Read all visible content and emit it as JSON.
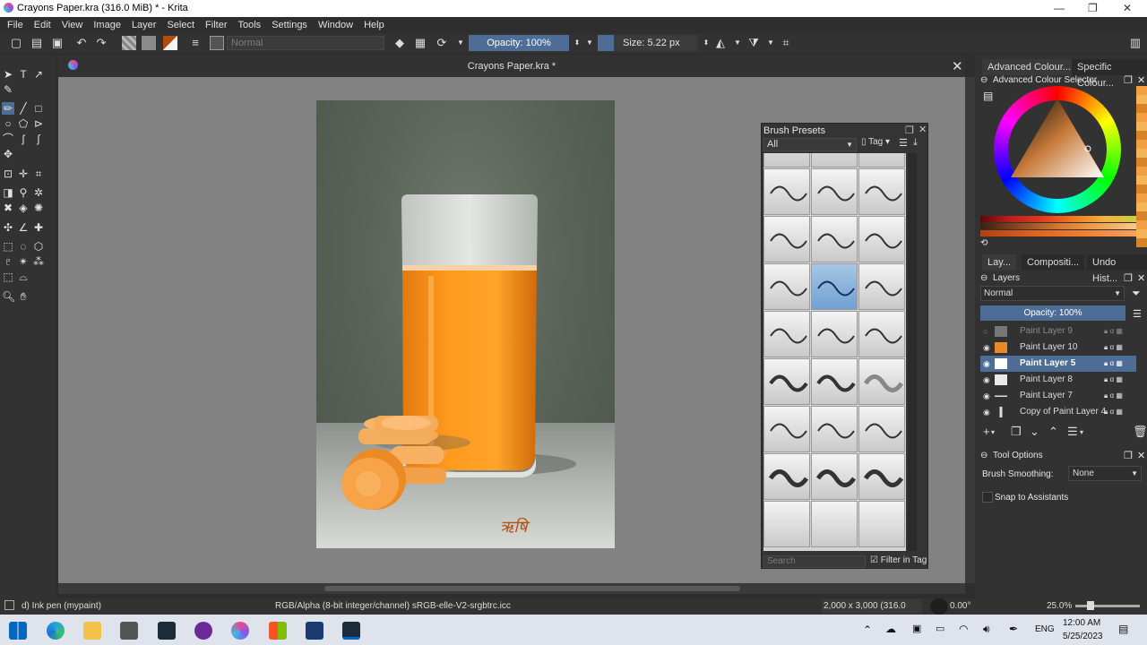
{
  "window": {
    "title": "Crayons Paper.kra (316.0 MiB)  * - Krita",
    "min": "—",
    "max": "❐",
    "close": "✕"
  },
  "menu": [
    "File",
    "Edit",
    "View",
    "Image",
    "Layer",
    "Select",
    "Filter",
    "Tools",
    "Settings",
    "Window",
    "Help"
  ],
  "toolbar": {
    "blend_mode": "Normal",
    "opacity": "Opacity: 100%",
    "size": "Size: 5.22 px"
  },
  "document": {
    "tab_name": "Crayons Paper.kra *"
  },
  "brush_presets": {
    "title": "Brush Presets",
    "tag_filter": "All",
    "tag_button": "Tag",
    "search_placeholder": "Search",
    "filter_in_tag": "Filter in Tag"
  },
  "right_dock": {
    "tabs_top": [
      "Advanced Colour...",
      "Specific Colour..."
    ],
    "colour_selector_title": "Advanced Colour Selector",
    "tabs_mid": [
      "Lay...",
      "Compositi...",
      "Undo Hist..."
    ],
    "layers_title": "Layers",
    "layers_blend": "Normal",
    "layers_opacity": "Opacity:  100%",
    "layers": [
      {
        "name": "Paint Layer 9"
      },
      {
        "name": "Paint Layer 10"
      },
      {
        "name": "Paint Layer 5"
      },
      {
        "name": "Paint Layer 8"
      },
      {
        "name": "Paint Layer 7"
      },
      {
        "name": "Copy of Paint Layer 4"
      }
    ],
    "tool_options_title": "Tool Options",
    "brush_smoothing_label": "Brush Smoothing:",
    "brush_smoothing_value": "None",
    "snap_label": "Snap to Assistants"
  },
  "status": {
    "brush": "d) Ink pen (mypaint)",
    "color_space": "RGB/Alpha (8-bit integer/channel)  sRGB-elle-V2-srgbtrc.icc",
    "dimensions": "2,000 x 3,000 (316.0 MiB)",
    "rotation": "0.00°",
    "zoom": "25.0%"
  },
  "taskbar": {
    "lang": "ENG",
    "time": "12:00 AM",
    "date": "5/25/2023"
  },
  "artwork": {
    "signature": "ऋषि"
  }
}
